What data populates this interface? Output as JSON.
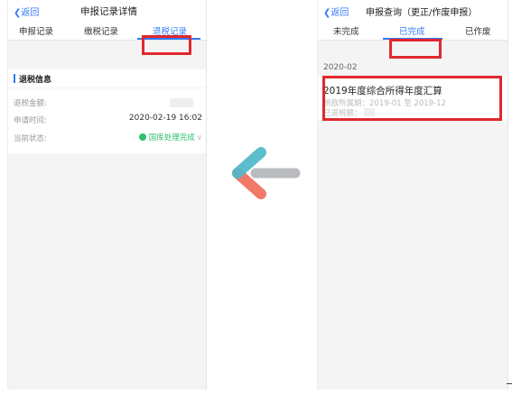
{
  "left": {
    "back_label": "返回",
    "title": "申报记录详情",
    "tabs": [
      "申报记录",
      "缴税记录",
      "退税记录"
    ],
    "active_tab_index": 2,
    "section_title": "退税信息",
    "fields": {
      "amount_label": "退税金额:",
      "time_label": "申请时间:",
      "time_value": "2020-02-19 16:02",
      "status_label": "当前状态:",
      "status_value": "国库处理完成"
    }
  },
  "right": {
    "back_label": "返回",
    "title": "申报查询（更正/作废申报）",
    "tabs": [
      "未完成",
      "已完成",
      "已作废"
    ],
    "active_tab_index": 1,
    "group_date": "2020-02",
    "record": {
      "title": "2019年度综合所得年度汇算",
      "period_label": "税款所属期：",
      "period_value": "2019-01 至 2019-12",
      "refund_label": "已退税额："
    }
  },
  "colors": {
    "accent": "#3478f6",
    "highlight_box": "#e0282e",
    "status_green": "#2fbf6b",
    "arrow_teal": "#4fb8c9",
    "arrow_coral": "#ef6f5b",
    "arrow_gray": "#b9bbbf"
  }
}
